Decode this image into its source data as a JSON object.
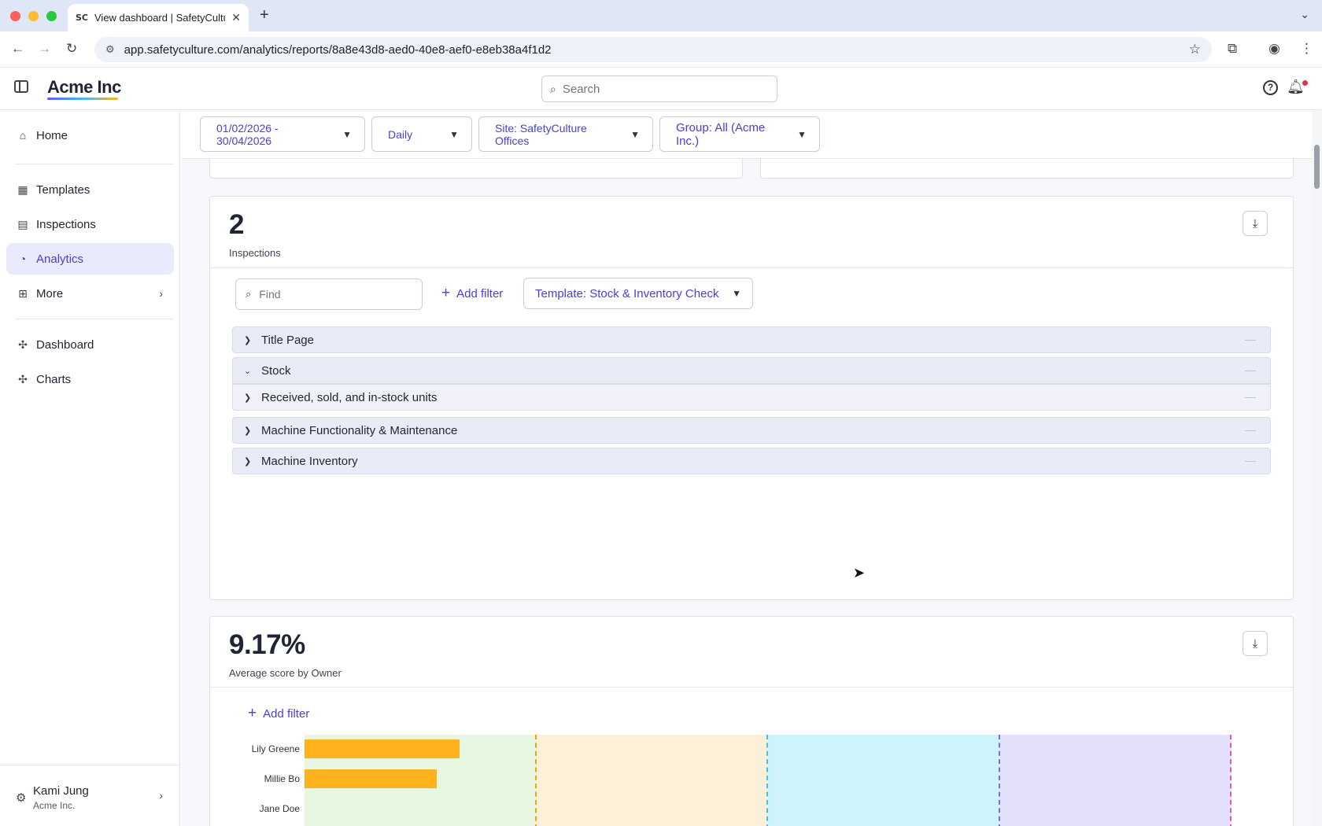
{
  "browser": {
    "tab_title": "View dashboard | SafetyCultu",
    "favicon_text": "SC",
    "url": "app.safetyculture.com/analytics/reports/8a8e43d8-aed0-40e8-aef0-e8eb38a4f1d2"
  },
  "header": {
    "brand": "Acme Inc",
    "search_placeholder": "Search",
    "help_label": "?"
  },
  "sidebar": {
    "items": [
      {
        "label": "Home",
        "icon": "home-icon"
      },
      {
        "label": "Templates",
        "icon": "templates-icon"
      },
      {
        "label": "Inspections",
        "icon": "inspections-icon"
      },
      {
        "label": "Analytics",
        "icon": "analytics-icon",
        "active": true
      },
      {
        "label": "More",
        "icon": "grid-icon"
      },
      {
        "label": "Dashboard",
        "icon": "puzzle-icon"
      },
      {
        "label": "Charts",
        "icon": "puzzle-icon"
      }
    ],
    "user": {
      "name": "Kami Jung",
      "org": "Acme Inc."
    }
  },
  "filters": {
    "date_range": "01/02/2026 - 30/04/2026",
    "interval": "Daily",
    "site": "Site: SafetyCulture Offices",
    "group": "Group: All (Acme Inc.)"
  },
  "inspections_card": {
    "value": "2",
    "label": "Inspections",
    "find_placeholder": "Find",
    "add_filter": "Add filter",
    "template_filter": "Template: Stock & Inventory Check",
    "sections": [
      {
        "label": "Title Page",
        "expanded": false
      },
      {
        "label": "Stock",
        "expanded": true
      },
      {
        "label": "Received, sold, and in-stock units",
        "expanded": false,
        "child": true
      },
      {
        "label": "Machine Functionality & Maintenance",
        "expanded": false
      },
      {
        "label": "Machine Inventory",
        "expanded": false
      }
    ]
  },
  "score_card": {
    "value": "9.17%",
    "label": "Average score by Owner",
    "add_filter": "Add filter"
  },
  "chart_data": {
    "type": "bar",
    "orientation": "horizontal",
    "categories": [
      "Lily Greene",
      "Millie Bo",
      "Jane Doe"
    ],
    "values": [
      16.7,
      14.3,
      0
    ],
    "xlim": [
      0,
      100
    ],
    "bands": [
      {
        "from": 0,
        "to": 25,
        "color": "#e8f7e1",
        "line": "#f0a500"
      },
      {
        "from": 25,
        "to": 50,
        "color": "#fdf0d9",
        "line": "#40c4d8"
      },
      {
        "from": 50,
        "to": 75,
        "color": "#cff3fb",
        "line": "#7b6fd6"
      },
      {
        "from": 75,
        "to": 100,
        "color": "#e2e0fb",
        "line": "#d858c8"
      }
    ],
    "bar_color": "#ffb21e"
  }
}
